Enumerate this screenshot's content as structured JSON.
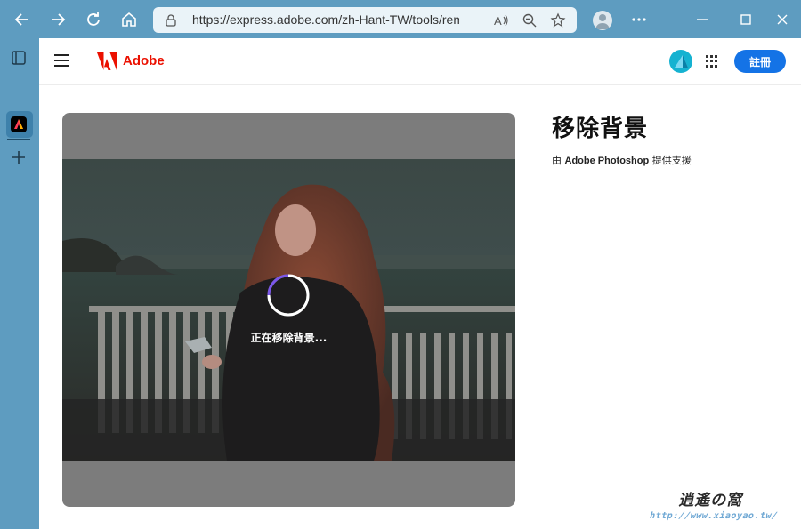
{
  "browser": {
    "url": "https://express.adobe.com/zh-Hant-TW/tools/remove-b..."
  },
  "header": {
    "brand": "Adobe",
    "signup_label": "註冊"
  },
  "main": {
    "status": "正在移除背景...",
    "title": "移除背景",
    "attribution_prefix": "由",
    "attribution_product": "Adobe Photoshop",
    "attribution_suffix": "提供支援"
  },
  "watermark": {
    "title": "逍遙の窩",
    "url": "http://www.xiaoyao.tw/"
  },
  "colors": {
    "browser_chrome": "#5e9cc0",
    "accent": "#1473e6",
    "adobe_red": "#eb1000",
    "preview_overlay": "#7c7c7c"
  },
  "icons": [
    "back-arrow-icon",
    "forward-arrow-icon",
    "refresh-icon",
    "home-icon",
    "lock-icon",
    "read-aloud-icon",
    "zoom-icon",
    "favorites-icon",
    "more-icon",
    "minimize-icon",
    "maximize-icon",
    "close-icon",
    "tab-panel-icon",
    "adobe-express-tab-icon",
    "new-tab-icon",
    "hamburger-icon",
    "adobe-logo-icon",
    "apps-grid-icon",
    "spinner-icon"
  ]
}
